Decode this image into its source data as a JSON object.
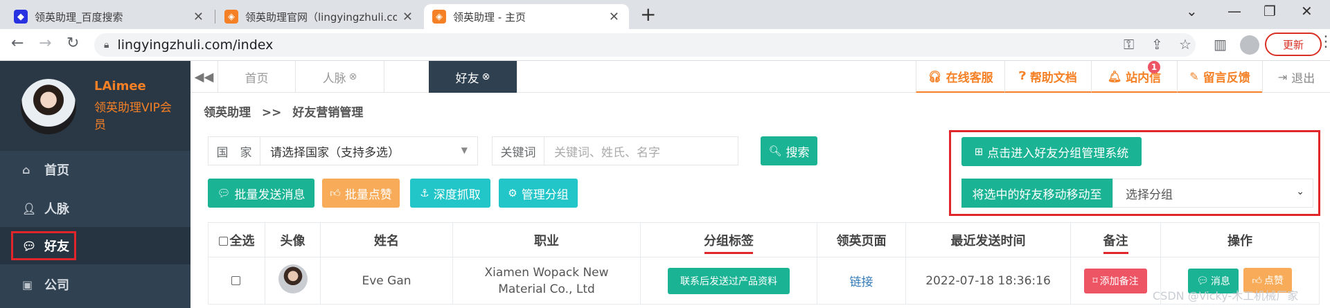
{
  "browser": {
    "tabs": [
      {
        "title": "领英助理_百度搜索",
        "favicon": "baidu-paw-icon"
      },
      {
        "title": "领英助理官网（lingyingzhuli.co",
        "favicon": "lingying-logo-icon"
      },
      {
        "title": "领英助理 - 主页",
        "favicon": "lingying-logo-icon"
      }
    ],
    "url": "lingyingzhuli.com/index",
    "update_label": "更新"
  },
  "sidebar": {
    "user_name": "LAimee",
    "user_level": "领英助理VIP会员",
    "items": [
      {
        "label": "首页",
        "icon": "home-icon"
      },
      {
        "label": "人脉",
        "icon": "add-user-icon"
      },
      {
        "label": "好友",
        "icon": "chat-bubbles-icon"
      },
      {
        "label": "公司",
        "icon": "briefcase-icon"
      }
    ]
  },
  "topnav": {
    "tabs": [
      "首页",
      "人脉",
      "好友"
    ],
    "links": [
      "在线客服",
      "帮助文档",
      "站内信",
      "留言反馈",
      "退出"
    ],
    "notification_count": "1"
  },
  "breadcrumb": {
    "root": "领英助理",
    "sep": ">>",
    "current": "好友营销管理"
  },
  "filters": {
    "country_label": "国　家",
    "country_value": "请选择国家（支持多选）",
    "keyword_label": "关键词",
    "keyword_placeholder": "关键词、姓氏、名字",
    "search_label": "搜索"
  },
  "actions": {
    "batch_message": "批量发送消息",
    "batch_like": "批量点赞",
    "deep_crawl": "深度抓取",
    "manage_groups": "管理分组",
    "enter_group_system": "点击进入好友分组管理系统",
    "move_to_label": "将选中的好友移动移动至",
    "group_select": "选择分组"
  },
  "table": {
    "headers": [
      "全选",
      "头像",
      "姓名",
      "职业",
      "分组标签",
      "领英页面",
      "最近发送时间",
      "备注",
      "操作"
    ],
    "rows": [
      {
        "name": "Eve Gan",
        "occupation": "Xiamen Wopack New Material Co., Ltd",
        "group_tag": "联系后发送过产品资料",
        "page_link": "链接",
        "last_sent": "2022-07-18 18:36:16",
        "note_action": "添加备注",
        "op_message": "消息",
        "op_like": "点赞"
      }
    ]
  },
  "watermark": "CSDN @Vicky-木工机械厂家",
  "colors": {
    "primary": "#1ab394",
    "accent": "#f58025",
    "sidebar": "#304151",
    "highlight": "#e0262b"
  }
}
